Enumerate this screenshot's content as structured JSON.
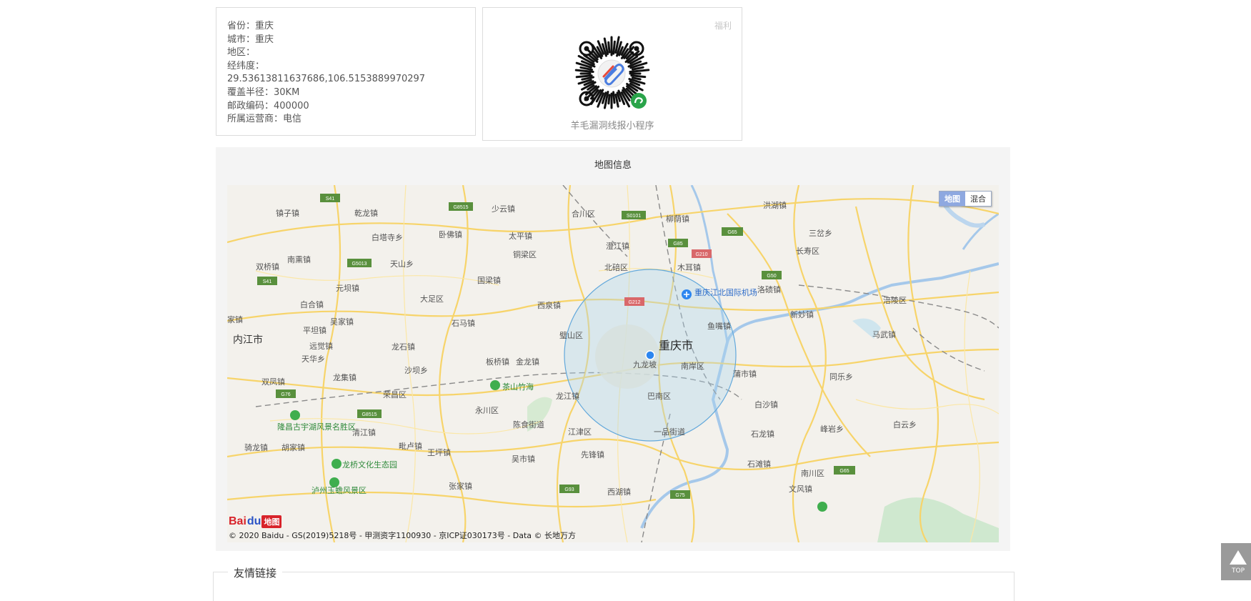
{
  "info": {
    "province": "省份：重庆",
    "city": "城市：重庆",
    "district": "地区：",
    "coords_label": "经纬度：",
    "coords_value": "29.53613811637686,106.5153889970297",
    "radius": "覆盖半径：30KM",
    "postcode": "邮政编码：400000",
    "carrier": "所属运营商：电信"
  },
  "qr": {
    "badge": "福利",
    "caption": "羊毛漏洞线报小程序"
  },
  "map": {
    "title": "地图信息",
    "toggle_map": "地图",
    "toggle_hybrid": "混合",
    "logo_text": "Bai",
    "logo_paw": "du",
    "logo_badge": "地图",
    "copyright": "© 2020 Baidu - GS(2019)5218号 - 甲测资字1100930 - 京ICP证030173号 - Data © 长地万方",
    "labels": {
      "city_main": "重庆市",
      "neijiang": "内江市",
      "jiulongpo": "九龙坡",
      "nanan": "南岸区",
      "banan": "巴南区",
      "jiangbei_airport": "重庆江北国际机场",
      "yubei_yuzui": "鱼嘴镇",
      "bishan": "璧山区",
      "beibei": "北碚区",
      "hechuan": "合川区",
      "tongliang": "铜梁区",
      "dazu": "大足区",
      "rongchang": "荣昌区",
      "yongchuan": "永川区",
      "jiangjin": "江津区",
      "changshou": "长寿区",
      "fuling": "涪陵区",
      "nanchuan": "南川区",
      "chashan": "茶山竹海",
      "longqiao": "龙桥文化生态园",
      "longchang": "隆昌古宇湖风景名胜区",
      "luzhou": "泸州玉蟾风景区",
      "xinmiao": "新妙镇",
      "mawu": "马武镇",
      "longxing": "洛碛镇",
      "tongle": "同乐乡",
      "baisha": "白沙镇",
      "shilong": "石龙镇",
      "yiping": "一品街道",
      "xianfeng": "先锋镇",
      "fengyan": "峰岩乡",
      "baiyun": "白云乡",
      "shitan": "石滩镇",
      "xihu": "西湖镇",
      "wengzi": "镇子镇",
      "qianlong": "乾龙镇",
      "shaoyun": "少云镇",
      "liuyin": "柳荫镇",
      "hongchi": "洪湖镇",
      "sanjiao": "三岔乡",
      "baitasi": "白塔寺乡",
      "wofo": "卧佛镇",
      "taiping": "太平镇",
      "chengtan": "澄江镇",
      "mu_er": "木耳镇",
      "nanxun": "南熏镇",
      "shuangqiao": "双桥镇",
      "tianshan": "天山乡",
      "yuanxun": "元坝镇",
      "guoliang": "国梁镇",
      "xiquan": "西泉镇",
      "shima": "石马镇",
      "baihe": "白合镇",
      "wujia": "吴家镇",
      "pingtan": "平坦镇",
      "yuanxian": "远觉镇",
      "tianhua": "天华乡",
      "longshi": "龙石镇",
      "banqiao": "板桥镇",
      "jinlong": "金龙镇",
      "shaqiao": "沙坝乡",
      "longji": "龙集镇",
      "shuangfeng": "双凤镇",
      "qingliu": "清江镇",
      "pilu": "毗卢镇",
      "wangping": "王坪镇",
      "chenshi": "陈食街道",
      "wushi": "吴市镇",
      "zhangjia": "张家镇",
      "qilong": "骑龙镇",
      "hujia": "胡家镇",
      "longjiang": "龙江镇",
      "pubei": "蒲市镇",
      "wenlong": "文风镇",
      "jiaxian": "家镇"
    },
    "highways": {
      "s41a": "S41",
      "g8515a": "G8515",
      "s0101": "S0101",
      "g65a": "G65",
      "g85": "G85",
      "g210": "G210",
      "g5013": "G5013",
      "s41b": "S41",
      "g50": "G50",
      "g212": "G212",
      "g76": "G76",
      "g8515b": "G8515",
      "g93": "G93",
      "g75": "G75",
      "g65b": "G65"
    }
  },
  "links": {
    "title": "友情链接"
  },
  "back_to_top": "TOP"
}
